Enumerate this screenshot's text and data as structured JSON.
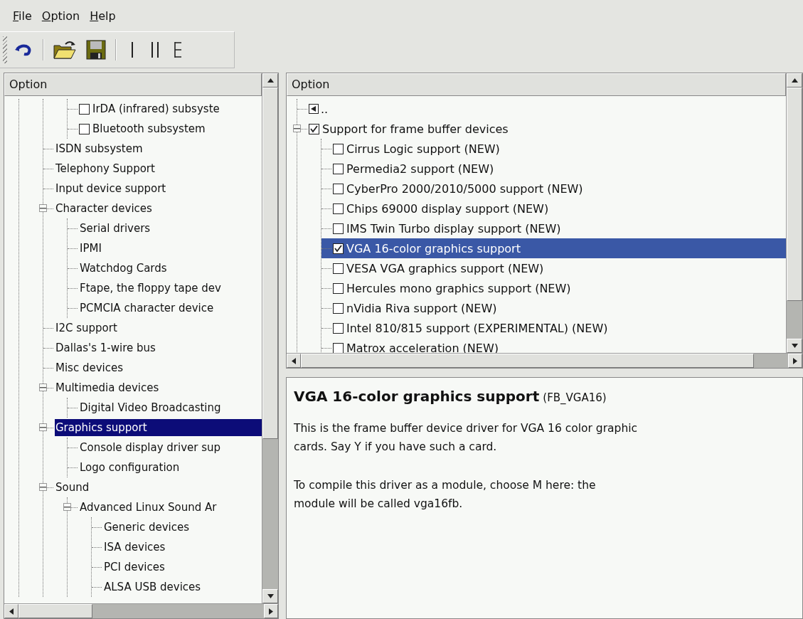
{
  "menu": [
    {
      "label": "File"
    },
    {
      "label": "Option"
    },
    {
      "label": "Help"
    }
  ],
  "toolbar": [
    {
      "kind": "undo"
    },
    {
      "kind": "sep"
    },
    {
      "kind": "open"
    },
    {
      "kind": "save"
    },
    {
      "kind": "sep"
    },
    {
      "kind": "single"
    },
    {
      "kind": "split"
    },
    {
      "kind": "full"
    }
  ],
  "left_tree": {
    "header": "Option",
    "items": [
      {
        "children": [
          {
            "children": [
              {
                "label": "IrDA (infrared) subsyste",
                "checked": false,
                "selected": false
              },
              {
                "label": "Bluetooth subsystem",
                "checked": false,
                "selected": false
              }
            ]
          },
          {
            "label": "ISDN subsystem",
            "selected": false
          },
          {
            "label": "Telephony Support",
            "selected": false
          },
          {
            "label": "Input device support",
            "selected": false
          },
          {
            "label": "Character devices",
            "expanded": true,
            "selected": false,
            "children": [
              {
                "label": "Serial drivers",
                "selected": false
              },
              {
                "label": "IPMI",
                "selected": false
              },
              {
                "label": "Watchdog Cards",
                "selected": false
              },
              {
                "label": "Ftape, the floppy tape dev",
                "selected": false
              },
              {
                "label": "PCMCIA character device",
                "selected": false
              }
            ]
          },
          {
            "label": "I2C support",
            "selected": false
          },
          {
            "label": "Dallas's 1-wire bus",
            "selected": false
          },
          {
            "label": "Misc devices",
            "selected": false
          },
          {
            "label": "Multimedia devices",
            "expanded": true,
            "selected": false,
            "children": [
              {
                "label": "Digital Video Broadcasting",
                "selected": false
              }
            ]
          },
          {
            "label": "Graphics support",
            "expanded": true,
            "selected": true,
            "children": [
              {
                "label": "Console display driver sup",
                "selected": false
              },
              {
                "label": "Logo configuration",
                "selected": false
              }
            ]
          },
          {
            "label": "Sound",
            "expanded": true,
            "selected": false,
            "children": [
              {
                "label": "Advanced Linux Sound Ar",
                "expanded": true,
                "selected": false,
                "children": [
                  {
                    "label": "Generic devices",
                    "selected": false
                  },
                  {
                    "label": "ISA devices",
                    "selected": false
                  },
                  {
                    "label": "PCI devices",
                    "selected": false
                  },
                  {
                    "label": "ALSA USB devices",
                    "selected": false
                  }
                ]
              }
            ]
          }
        ]
      }
    ]
  },
  "right_tree": {
    "header": "Option",
    "items": [
      {
        "label": "..",
        "kind": "up",
        "selected": false
      },
      {
        "label": "Support for frame buffer devices",
        "checked": true,
        "expanded": true,
        "selected": false,
        "children": [
          {
            "label": "Cirrus Logic support (NEW)",
            "checked": false,
            "selected": false
          },
          {
            "label": "Permedia2 support (NEW)",
            "checked": false,
            "selected": false
          },
          {
            "label": "CyberPro 2000/2010/5000 support (NEW)",
            "checked": false,
            "selected": false
          },
          {
            "label": "Chips 69000 display support (NEW)",
            "checked": false,
            "selected": false
          },
          {
            "label": "IMS Twin Turbo display support (NEW)",
            "checked": false,
            "selected": false
          },
          {
            "label": "VGA 16-color graphics support",
            "checked": true,
            "selected": true
          },
          {
            "label": "VESA VGA graphics support (NEW)",
            "checked": false,
            "selected": false
          },
          {
            "label": "Hercules mono graphics support (NEW)",
            "checked": false,
            "selected": false
          },
          {
            "label": "nVidia Riva support (NEW)",
            "checked": false,
            "selected": false
          },
          {
            "label": "Intel 810/815 support (EXPERIMENTAL) (NEW)",
            "checked": false,
            "selected": false
          },
          {
            "label": "Matrox acceleration (NEW)",
            "checked": false,
            "selected": false
          }
        ]
      }
    ]
  },
  "help": {
    "title": "VGA 16-color graphics support",
    "symbol": "(FB_VGA16)",
    "paragraphs": [
      [
        "This is the frame buffer device driver for VGA 16 color graphic",
        "cards. Say Y if you have such a card."
      ],
      [
        "To compile this driver as a module, choose M here: the",
        "module will be called vga16fb."
      ]
    ]
  }
}
